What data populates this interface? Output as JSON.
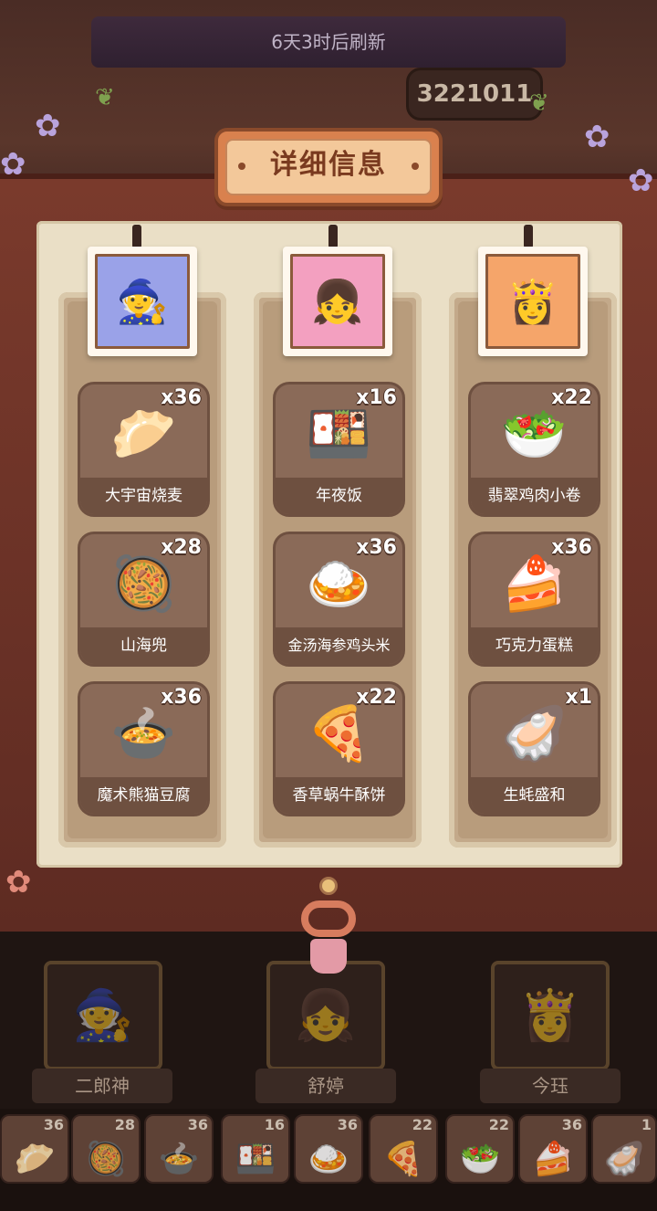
{
  "header": {
    "refresh_text": "6天3时后刷新",
    "counter_value": "3221011"
  },
  "title": "详细信息",
  "columns": [
    {
      "portrait_icon": "🧙",
      "portrait_bg": "#9aa2e8",
      "dishes": [
        {
          "name": "大宇宙烧麦",
          "count": "x36",
          "icon": "🥟"
        },
        {
          "name": "山海兜",
          "count": "x28",
          "icon": "🥘"
        },
        {
          "name": "魔术熊猫豆腐",
          "count": "x36",
          "icon": "🍲"
        }
      ]
    },
    {
      "portrait_icon": "👧",
      "portrait_bg": "#f3a0c0",
      "dishes": [
        {
          "name": "年夜饭",
          "count": "x16",
          "icon": "🍱"
        },
        {
          "name": "金汤海参鸡头米",
          "count": "x36",
          "icon": "🍛"
        },
        {
          "name": "香草蜗牛酥饼",
          "count": "x22",
          "icon": "🍕"
        }
      ]
    },
    {
      "portrait_icon": "👸",
      "portrait_bg": "#f5a56a",
      "dishes": [
        {
          "name": "翡翠鸡肉小卷",
          "count": "x22",
          "icon": "🥗"
        },
        {
          "name": "巧克力蛋糕",
          "count": "x36",
          "icon": "🍰"
        },
        {
          "name": "生蚝盛和",
          "count": "x1",
          "icon": "🦪"
        }
      ]
    }
  ],
  "heroes": [
    {
      "name": "二郎神",
      "icon": "🧙"
    },
    {
      "name": "舒婷",
      "icon": "👧"
    },
    {
      "name": "今珏",
      "icon": "👸"
    }
  ],
  "strip": [
    {
      "count": "36",
      "icon": "🥟"
    },
    {
      "count": "28",
      "icon": "🥘"
    },
    {
      "count": "36",
      "icon": "🍲"
    },
    {
      "count": "16",
      "icon": "🍱"
    },
    {
      "count": "36",
      "icon": "🍛"
    },
    {
      "count": "22",
      "icon": "🍕"
    },
    {
      "count": "22",
      "icon": "🥗"
    },
    {
      "count": "36",
      "icon": "🍰"
    },
    {
      "count": "1",
      "icon": "🦪"
    }
  ]
}
